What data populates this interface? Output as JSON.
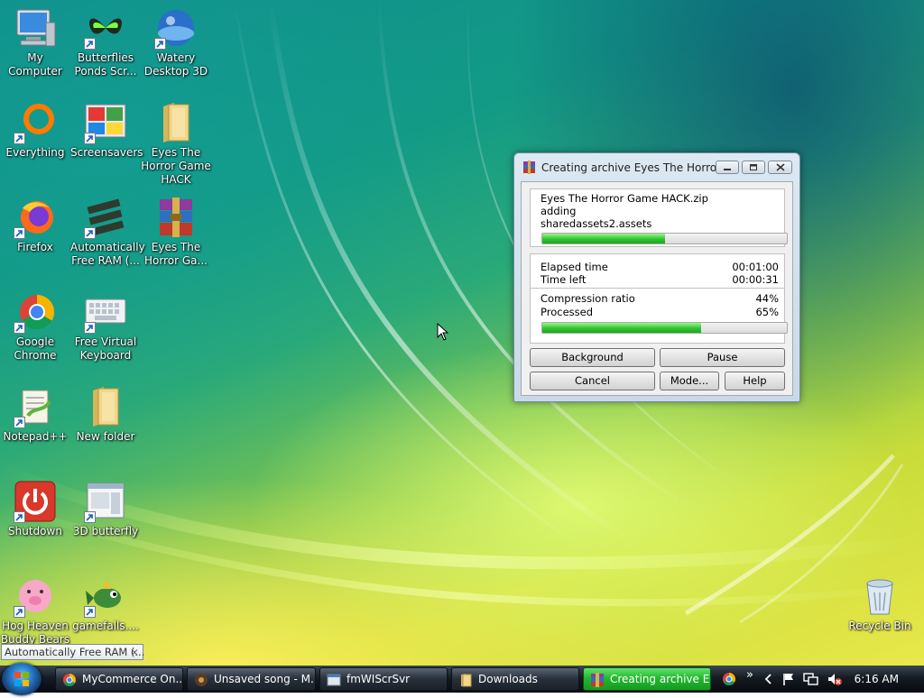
{
  "desktop": {
    "icons": [
      {
        "label": "My Computer"
      },
      {
        "label": "Butterflies Ponds Scr..."
      },
      {
        "label": "Watery Desktop 3D"
      },
      {
        "label": "Everything"
      },
      {
        "label": "Screensavers"
      },
      {
        "label": "Eyes The Horror Game HACK"
      },
      {
        "label": "Firefox"
      },
      {
        "label": "Automatically Free RAM (..."
      },
      {
        "label": "Eyes The Horror Ga..."
      },
      {
        "label": "Google Chrome"
      },
      {
        "label": "Free Virtual Keyboard"
      },
      {
        "label": "Notepad++"
      },
      {
        "label": "New folder"
      },
      {
        "label": "Shutdown"
      },
      {
        "label": "3D butterfly"
      },
      {
        "label": "Hog Heaven Buddy Bears"
      },
      {
        "label": "gamefalls...."
      },
      {
        "label": "Recycle Bin"
      }
    ]
  },
  "tooltip": {
    "text": "Automatically Free RAM (...",
    "close": "×"
  },
  "dialog": {
    "title": "Creating archive Eyes The Horror ...",
    "archive_name": "Eyes The Horror Game HACK.zip",
    "action": "adding",
    "current_file": "sharedassets2.assets",
    "file_progress": 0.5,
    "elapsed_label": "Elapsed time",
    "elapsed_value": "00:01:00",
    "left_label": "Time left",
    "left_value": "00:00:31",
    "ratio_label": "Compression ratio",
    "ratio_value": "44%",
    "processed_label": "Processed",
    "processed_value": "65%",
    "processed_progress": 0.65,
    "buttons": {
      "background": "Background",
      "pause": "Pause",
      "cancel": "Cancel",
      "mode": "Mode...",
      "help": "Help"
    }
  },
  "taskbar": {
    "items": [
      {
        "label": "MyCommerce On..."
      },
      {
        "label": "Unsaved song - M..."
      },
      {
        "label": "fmWIScrSvr"
      },
      {
        "label": "Downloads"
      },
      {
        "label": "Creating archive E..."
      }
    ],
    "overflow": "»",
    "clock": "6:16 AM"
  },
  "colors": {
    "accent": "#2fc52f",
    "taskbar": "#151b22",
    "active_task": "#23b52f"
  }
}
